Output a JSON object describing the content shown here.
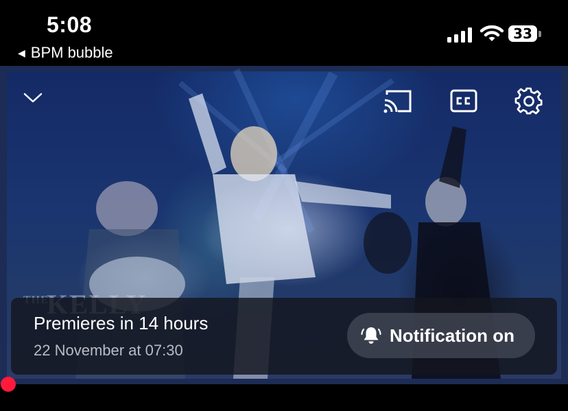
{
  "status_bar": {
    "time": "5:08",
    "back_label": "BPM bubble",
    "battery_percent": "33",
    "signal_icon": "cellular-signal-icon",
    "wifi_icon": "wifi-icon"
  },
  "player": {
    "collapse_icon": "chevron-down-icon",
    "cast_icon": "cast-icon",
    "captions_icon": "closed-captions-icon",
    "settings_icon": "gear-icon",
    "watermark_small": "THE",
    "watermark_big": "KELLY",
    "premiere_title": "Premieres in 14 hours",
    "premiere_date": "22 November at 07:30",
    "notification_label": "Notification on",
    "notification_icon": "bell-ringing-icon",
    "progress_color": "#ff1a3c",
    "progress": 0
  }
}
